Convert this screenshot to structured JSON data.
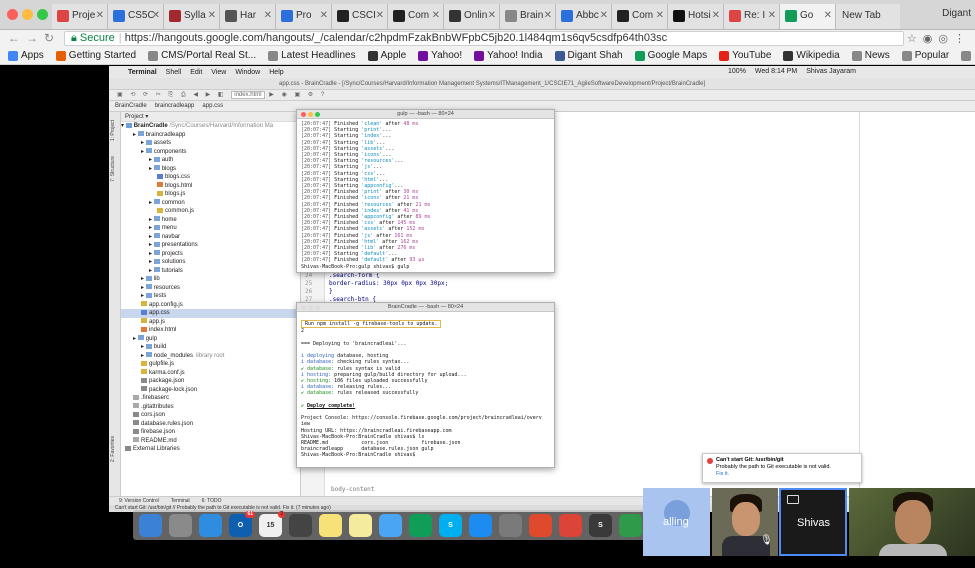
{
  "browser": {
    "tabs": [
      {
        "label": "Proje",
        "icon_color": "#d44"
      },
      {
        "label": "CS5C",
        "icon_color": "#2a6fdb"
      },
      {
        "label": "Sylla",
        "icon_color": "#a0282e"
      },
      {
        "label": "Har",
        "icon_color": "#555"
      },
      {
        "label": "Pro",
        "icon_color": "#2a6fdb"
      },
      {
        "label": "CSCI",
        "icon_color": "#222"
      },
      {
        "label": "Com",
        "icon_color": "#222"
      },
      {
        "label": "Onlin",
        "icon_color": "#333"
      },
      {
        "label": "Brain",
        "icon_color": "#888"
      },
      {
        "label": "Abbc",
        "icon_color": "#2a6fdb"
      },
      {
        "label": "Com",
        "icon_color": "#222"
      },
      {
        "label": "Hotsi",
        "icon_color": "#111"
      },
      {
        "label": "Re: I",
        "icon_color": "#d44"
      },
      {
        "label": "Go",
        "icon_color": "#0f9d58"
      }
    ],
    "new_tab_label": "New Tab",
    "profile_name": "Digant",
    "secure_label": "Secure",
    "url": "https://hangouts.google.com/hangouts/_/calendar/c2hpdmFzakBnbWFpbC5jb20.1l484qm1s6qv5csdfp64th03sc",
    "bookmarks": [
      {
        "label": "Apps",
        "icon": "apps-grid-icon",
        "color": "#4285f4"
      },
      {
        "label": "Getting Started",
        "icon": "firefox-icon",
        "color": "#e66000"
      },
      {
        "label": "CMS/Portal Real St...",
        "icon": "page-icon",
        "color": "#888"
      },
      {
        "label": "Latest Headlines",
        "icon": "page-icon",
        "color": "#888"
      },
      {
        "label": "Apple",
        "icon": "apple-icon",
        "color": "#333"
      },
      {
        "label": "Yahoo!",
        "icon": "yahoo-icon",
        "color": "#720e9e"
      },
      {
        "label": "Yahoo! India",
        "icon": "yahoo-icon",
        "color": "#720e9e"
      },
      {
        "label": "Digant Shah",
        "icon": "facebook-icon",
        "color": "#3b5998"
      },
      {
        "label": "Google Maps",
        "icon": "maps-icon",
        "color": "#0f9d58"
      },
      {
        "label": "YouTube",
        "icon": "youtube-icon",
        "color": "#e62117"
      },
      {
        "label": "Wikipedia",
        "icon": "wikipedia-icon",
        "color": "#333"
      },
      {
        "label": "News",
        "icon": "folder-icon",
        "color": "#888"
      },
      {
        "label": "Popular",
        "icon": "folder-icon",
        "color": "#888"
      },
      {
        "label": "Most Popular Items...",
        "icon": "folder-icon",
        "color": "#888"
      }
    ]
  },
  "mac": {
    "menu": [
      "Terminal",
      "Shell",
      "Edit",
      "View",
      "Window",
      "Help"
    ],
    "battery": "100%",
    "clock": "Wed 8:14 PM",
    "user": "Shivas Jayaram"
  },
  "ide": {
    "title": "app.css - BrainCradle - [/Sync/Courses/Harvard/Information Management Systems/ITManagement_1/CSCIE71_AgileSoftwareDevelopment/Project/BrainCradle]",
    "crumbs": [
      "BrainCradle",
      "braincradleapp",
      "app.css"
    ],
    "run_config": "index.html",
    "project_header": "Project",
    "root_label": "BrainCradle",
    "root_path": "/Sync/Courses/Harvard/Information Ma",
    "tree": [
      {
        "label": "braincradleapp",
        "indent": 1,
        "type": "folder"
      },
      {
        "label": "assets",
        "indent": 2,
        "type": "folder"
      },
      {
        "label": "components",
        "indent": 2,
        "type": "folder"
      },
      {
        "label": "auth",
        "indent": 3,
        "type": "folder"
      },
      {
        "label": "blogs",
        "indent": 3,
        "type": "folder"
      },
      {
        "label": "blogs.css",
        "indent": 4,
        "type": "css"
      },
      {
        "label": "blogs.html",
        "indent": 4,
        "type": "html"
      },
      {
        "label": "blogs.js",
        "indent": 4,
        "type": "js"
      },
      {
        "label": "common",
        "indent": 3,
        "type": "folder"
      },
      {
        "label": "common.js",
        "indent": 4,
        "type": "js"
      },
      {
        "label": "home",
        "indent": 3,
        "type": "folder"
      },
      {
        "label": "menu",
        "indent": 3,
        "type": "folder"
      },
      {
        "label": "navbar",
        "indent": 3,
        "type": "folder"
      },
      {
        "label": "presentations",
        "indent": 3,
        "type": "folder"
      },
      {
        "label": "projects",
        "indent": 3,
        "type": "folder"
      },
      {
        "label": "solutions",
        "indent": 3,
        "type": "folder"
      },
      {
        "label": "tutorials",
        "indent": 3,
        "type": "folder"
      },
      {
        "label": "lib",
        "indent": 2,
        "type": "folder"
      },
      {
        "label": "resources",
        "indent": 2,
        "type": "folder"
      },
      {
        "label": "tests",
        "indent": 2,
        "type": "folder"
      },
      {
        "label": "app.config.js",
        "indent": 2,
        "type": "js"
      },
      {
        "label": "app.css",
        "indent": 2,
        "type": "css",
        "selected": true
      },
      {
        "label": "app.js",
        "indent": 2,
        "type": "js"
      },
      {
        "label": "index.html",
        "indent": 2,
        "type": "html"
      },
      {
        "label": "gulp",
        "indent": 1,
        "type": "folder"
      },
      {
        "label": "build",
        "indent": 2,
        "type": "folder"
      },
      {
        "label": "node_modules",
        "indent": 2,
        "type": "folder",
        "note": "library root"
      },
      {
        "label": "gulpfile.js",
        "indent": 2,
        "type": "js"
      },
      {
        "label": "karma.conf.js",
        "indent": 2,
        "type": "js"
      },
      {
        "label": "package.json",
        "indent": 2,
        "type": "json"
      },
      {
        "label": "package-lock.json",
        "indent": 2,
        "type": "json"
      },
      {
        "label": ".firebaserc",
        "indent": 1,
        "type": "file"
      },
      {
        "label": ".gitattributes",
        "indent": 1,
        "type": "file"
      },
      {
        "label": "cors.json",
        "indent": 1,
        "type": "json"
      },
      {
        "label": "database.rules.json",
        "indent": 1,
        "type": "json"
      },
      {
        "label": "firebase.json",
        "indent": 1,
        "type": "json"
      },
      {
        "label": "README.md",
        "indent": 1,
        "type": "file"
      },
      {
        "label": "External Libraries",
        "indent": 0,
        "type": "lib"
      }
    ],
    "side_tabs": [
      "1: Project",
      "7: Structure",
      "2: Favorites"
    ],
    "code_lines": [
      {
        "num": "24",
        "text": "  .search-form {"
      },
      {
        "num": "25",
        "text": "      border-radius: 30px 0px 0px 30px;"
      },
      {
        "num": "26",
        "text": "  }"
      },
      {
        "num": "27",
        "text": "  .search-btn {"
      },
      {
        "num": "28",
        "text": "      border-radius: 0px 30px 30px 0px;"
      }
    ],
    "editor_footer": "body-content",
    "bottom_tabs": [
      "9: Version Control",
      "Terminal",
      "6: TODO"
    ],
    "status": "Can't start Git: /usr/bin/git // Probably the path to Git executable is not valid. Fix it. (7 minutes ago)"
  },
  "terminal1": {
    "title": "gulp — -bash — 80×24",
    "lines": [
      {
        "ts": "[20:07:47]",
        "verb": "Finished",
        "task": "'clean'",
        "rest": " after ",
        "time": "48 ms"
      },
      {
        "ts": "[20:07:47]",
        "verb": "Starting",
        "task": "'print'",
        "rest": "...",
        "time": ""
      },
      {
        "ts": "[20:07:47]",
        "verb": "Starting",
        "task": "'index'",
        "rest": "...",
        "time": ""
      },
      {
        "ts": "[20:07:47]",
        "verb": "Starting",
        "task": "'lib'",
        "rest": "...",
        "time": ""
      },
      {
        "ts": "[20:07:47]",
        "verb": "Starting",
        "task": "'assets'",
        "rest": "...",
        "time": ""
      },
      {
        "ts": "[20:07:47]",
        "verb": "Starting",
        "task": "'icons'",
        "rest": "...",
        "time": ""
      },
      {
        "ts": "[20:07:47]",
        "verb": "Starting",
        "task": "'resources'",
        "rest": "...",
        "time": ""
      },
      {
        "ts": "[20:07:47]",
        "verb": "Starting",
        "task": "'js'",
        "rest": "...",
        "time": ""
      },
      {
        "ts": "[20:07:47]",
        "verb": "Starting",
        "task": "'css'",
        "rest": "...",
        "time": ""
      },
      {
        "ts": "[20:07:47]",
        "verb": "Starting",
        "task": "'html'",
        "rest": "...",
        "time": ""
      },
      {
        "ts": "[20:07:47]",
        "verb": "Starting",
        "task": "'appconfig'",
        "rest": "...",
        "time": ""
      },
      {
        "ts": "[20:07:47]",
        "verb": "Finished",
        "task": "'print'",
        "rest": " after ",
        "time": "30 ms"
      },
      {
        "ts": "[20:07:47]",
        "verb": "Finished",
        "task": "'icons'",
        "rest": " after ",
        "time": "21 ms"
      },
      {
        "ts": "[20:07:47]",
        "verb": "Finished",
        "task": "'resources'",
        "rest": " after ",
        "time": "21 ms"
      },
      {
        "ts": "[20:07:47]",
        "verb": "Finished",
        "task": "'index'",
        "rest": " after ",
        "time": "41 ms"
      },
      {
        "ts": "[20:07:47]",
        "verb": "Finished",
        "task": "'appconfig'",
        "rest": " after ",
        "time": "89 ms"
      },
      {
        "ts": "[20:07:47]",
        "verb": "Finished",
        "task": "'css'",
        "rest": " after ",
        "time": "145 ms"
      },
      {
        "ts": "[20:07:47]",
        "verb": "Finished",
        "task": "'assets'",
        "rest": " after ",
        "time": "152 ms"
      },
      {
        "ts": "[20:07:47]",
        "verb": "Finished",
        "task": "'js'",
        "rest": " after ",
        "time": "161 ms"
      },
      {
        "ts": "[20:07:47]",
        "verb": "Finished",
        "task": "'html'",
        "rest": " after ",
        "time": "162 ms"
      },
      {
        "ts": "[20:07:47]",
        "verb": "Finished",
        "task": "'lib'",
        "rest": " after ",
        "time": "276 ms"
      },
      {
        "ts": "[20:07:47]",
        "verb": "Starting",
        "task": "'default'",
        "rest": "...",
        "time": ""
      },
      {
        "ts": "[20:07:47]",
        "verb": "Finished",
        "task": "'default'",
        "rest": " after ",
        "time": "93 μs"
      }
    ],
    "prompt": "Shivas-MacBook-Pro:gulp shivas$ gulp"
  },
  "terminal2": {
    "title": "BrainCradle — -bash — 80×24",
    "update_notice": "Run npm install -g firebase-tools to update.",
    "lines": [
      {
        "kind": "plain",
        "text": "2"
      },
      {
        "kind": "plain",
        "text": ""
      },
      {
        "kind": "plain",
        "text": "=== Deploying to 'braincradleai'..."
      },
      {
        "kind": "plain",
        "text": ""
      },
      {
        "kind": "info",
        "mark": "i",
        "label": "deploying",
        "text": " database, hosting"
      },
      {
        "kind": "info",
        "mark": "i",
        "label": "database:",
        "text": " checking rules syntax..."
      },
      {
        "kind": "ok",
        "mark": "✔",
        "label": "database:",
        "text": " rules syntax is valid"
      },
      {
        "kind": "info",
        "mark": "i",
        "label": "hosting:",
        "text": " preparing gulp/build directory for upload..."
      },
      {
        "kind": "ok",
        "mark": "✔",
        "label": "hosting:",
        "text": " 106 files uploaded successfully"
      },
      {
        "kind": "info",
        "mark": "i",
        "label": "database:",
        "text": " releasing rules..."
      },
      {
        "kind": "ok",
        "mark": "✔",
        "label": "database:",
        "text": " rules released successfully"
      },
      {
        "kind": "plain",
        "text": ""
      },
      {
        "kind": "ok",
        "mark": "✔",
        "label": "Deploy complete!",
        "text": ""
      },
      {
        "kind": "plain",
        "text": ""
      },
      {
        "kind": "plain",
        "text": "Project Console: https://console.firebase.google.com/project/braincradleai/overv"
      },
      {
        "kind": "plain",
        "text": "iew"
      },
      {
        "kind": "plain",
        "text": "Hosting URL: https://braincradleai.firebaseapp.com"
      },
      {
        "kind": "plain",
        "text": "Shivas-MacBook-Pro:BrainCradle shivas$ ls"
      },
      {
        "kind": "plain",
        "text": "README.md           cors.json           firebase.json"
      },
      {
        "kind": "plain",
        "text": "braincradleapp      database.rules.json gulp"
      },
      {
        "kind": "plain",
        "text": "Shivas-MacBook-Pro:BrainCradle shivas$ "
      }
    ]
  },
  "notification": {
    "title": "Can't start Git: /usr/bin/git",
    "body": "Probably the path to Git executable is not valid.",
    "link": "Fix it."
  },
  "dock": {
    "apps": [
      {
        "name": "finder-icon",
        "color": "#3b82d6",
        "label": "",
        "badge": ""
      },
      {
        "name": "launchpad-icon",
        "color": "#8a8a8a",
        "label": "",
        "badge": ""
      },
      {
        "name": "safari-icon",
        "color": "#2e8de0",
        "label": "",
        "badge": ""
      },
      {
        "name": "outlook-icon",
        "color": "#0f5fb0",
        "label": "O",
        "badge": "61"
      },
      {
        "name": "calendar-icon",
        "color": "#f0f0f0",
        "label": "15",
        "badge": "3"
      },
      {
        "name": "calculator-icon",
        "color": "#444",
        "label": "",
        "badge": ""
      },
      {
        "name": "notes-icon",
        "color": "#f7e27a",
        "label": "",
        "badge": ""
      },
      {
        "name": "stickies-icon",
        "color": "#f4ec9c",
        "label": "",
        "badge": ""
      },
      {
        "name": "messages-icon",
        "color": "#4aa6f5",
        "label": "",
        "badge": ""
      },
      {
        "name": "hangouts-icon",
        "color": "#0f9d58",
        "label": "",
        "badge": ""
      },
      {
        "name": "skype-icon",
        "color": "#00aff0",
        "label": "S",
        "badge": ""
      },
      {
        "name": "app-store-icon",
        "color": "#1c8cf0",
        "label": "",
        "badge": ""
      },
      {
        "name": "system-preferences-icon",
        "color": "#7a7a7a",
        "label": "",
        "badge": ""
      },
      {
        "name": "intellij-icon",
        "color": "#e04a2c",
        "label": "",
        "badge": ""
      },
      {
        "name": "chrome-icon",
        "color": "#db4437",
        "label": "",
        "badge": ""
      },
      {
        "name": "sublime-icon",
        "color": "#3a3a3a",
        "label": "S",
        "badge": ""
      },
      {
        "name": "vim-icon",
        "color": "#2e9a4a",
        "label": "",
        "badge": ""
      }
    ]
  },
  "video": {
    "tile1_label": "alling",
    "tile3_label": "Shivas"
  }
}
